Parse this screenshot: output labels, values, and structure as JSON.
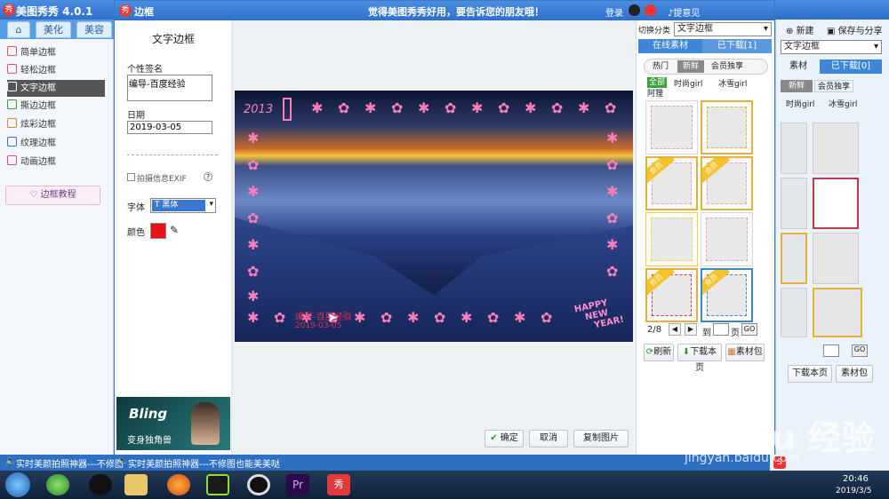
{
  "app": {
    "title": "美图秀秀 4.0.1",
    "tabs": [
      "美化",
      "美容"
    ],
    "sidebar": [
      "简单边框",
      "轻松边框",
      "文字边框",
      "撕边边框",
      "炫彩边框",
      "纹理边框",
      "动画边框"
    ],
    "tutorial": "边框教程",
    "right_actions": {
      "new": "新建",
      "save_share": "保存与分享"
    }
  },
  "dialog": {
    "title": "边框",
    "ad": "觉得美图秀秀好用，要告诉您的朋友哦！",
    "login": "登录",
    "feedback": "提意见",
    "panel": {
      "heading": "文字边框",
      "signature_label": "个性签名",
      "signature_value": "编导-百度经验",
      "date_label": "日期",
      "date_value": "2019-03-05",
      "exif_label": "拍摄信息EXIF",
      "font_label": "字体",
      "font_value": "黑体",
      "color_label": "颜色",
      "color_value": "#e8141a",
      "promo": {
        "brand": "Bling",
        "caption": "变身独角兽"
      }
    },
    "photo": {
      "year": "2013",
      "overlay_line1": "编导-百度经验",
      "overlay_line2": "2019-03-05",
      "greeting_line1": "HAPPY",
      "greeting_line2": "NEW",
      "greeting_line3": "YEAR!"
    },
    "buttons": {
      "ok": "确定",
      "cancel": "取消",
      "copy": "复制图片"
    },
    "material": {
      "category_label": "切换分类",
      "category_value": "文字边框",
      "tab_online": "在线素材",
      "tab_downloaded": "已下载[1]",
      "filters": [
        "热门",
        "新鲜",
        "会员独享"
      ],
      "sub_filters": [
        "全部",
        "时尚girl",
        "冰雪girl",
        "阿狸"
      ],
      "pagination": {
        "page": "2/8",
        "goto_label": "到",
        "page_unit": "页",
        "go": "GO"
      },
      "actions": {
        "refresh": "刷新",
        "download_page": "下载本页",
        "package": "素材包"
      }
    }
  },
  "background_panel": {
    "category_value": "文字边框",
    "tab_material": "素材",
    "tab_downloaded": "已下载[0]",
    "filters": [
      "新鲜",
      "会员独享"
    ],
    "sub_filters": [
      "时尚girl",
      "冰雪girl"
    ],
    "download_page": "下载本页",
    "package": "素材包"
  },
  "news": "实时美颜拍照神器---不修图也能美美哒",
  "news_short": "实时美颜拍照神器---不修图",
  "taskbar": {
    "time": "20:46",
    "date": "2019/3/5"
  },
  "watermark": {
    "line1": "Bai du 经验",
    "line2": "jingyan.baidu.com"
  }
}
